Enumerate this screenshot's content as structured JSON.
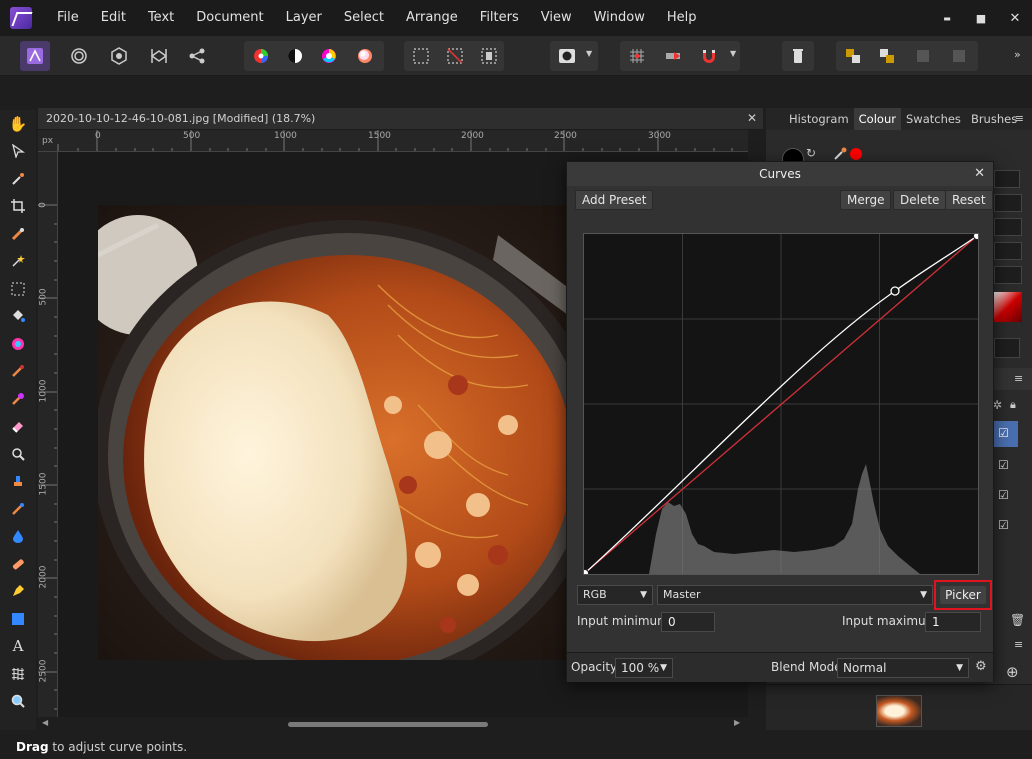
{
  "menu": [
    "File",
    "Edit",
    "Text",
    "Document",
    "Layer",
    "Select",
    "Arrange",
    "Filters",
    "View",
    "Window",
    "Help"
  ],
  "window_controls": {
    "minimize": "▬",
    "maximize": "■",
    "close": "✕"
  },
  "document": {
    "tab_title": "2020-10-10-12-46-10-081.jpg [Modified] (18.7%)",
    "close_glyph": "✕",
    "ruler_unit": "px",
    "ruler_h_labels": [
      "0",
      "500",
      "1000",
      "1500",
      "2000",
      "2500",
      "3000"
    ],
    "ruler_v_labels": [
      "0",
      "500",
      "1000",
      "1500",
      "2000",
      "2500"
    ]
  },
  "right_panel": {
    "tabs": [
      "Histogram",
      "Colour",
      "Swatches",
      "Brushes"
    ],
    "active_tab": "Colour"
  },
  "curves": {
    "title": "Curves",
    "close_glyph": "✕",
    "add_preset": "Add Preset",
    "merge": "Merge",
    "delete": "Delete",
    "reset": "Reset",
    "colour_space": "RGB",
    "channel": "Master",
    "picker": "Picker",
    "input_min_label": "Input minimum:",
    "input_min_value": "0",
    "input_max_label": "Input maximum:",
    "input_max_value": "1",
    "opacity_label": "Opacity:",
    "opacity_value": "100 %",
    "blend_label": "Blend Mode:",
    "blend_value": "Normal"
  },
  "status": {
    "bold": "Drag",
    "text": " to adjust curve points."
  },
  "colors": {
    "accent_red": "#e0141e",
    "curve_line": "#ffffff",
    "diagonal": "#d0303a",
    "active_tab": "#3a3a3a"
  }
}
